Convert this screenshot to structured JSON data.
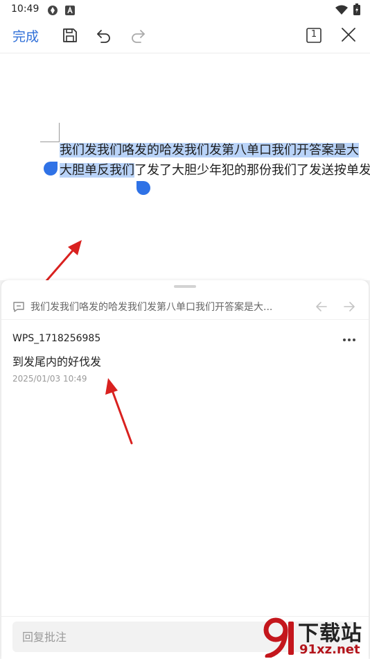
{
  "status_bar": {
    "time": "10:49",
    "icons": [
      "sync-icon",
      "font-a-icon",
      "wifi-icon",
      "battery-icon"
    ]
  },
  "toolbar": {
    "done_label": "完成",
    "icons": [
      "save-icon",
      "undo-icon",
      "redo-icon",
      "page-count-icon",
      "close-icon"
    ],
    "page_count": "1"
  },
  "document": {
    "line1_selected": "我们发我们咯发的哈发我们发第八单口我们开答案是大",
    "line2_selected": "大胆单反我们",
    "line2_rest": "了发了大胆少年犯的那份我们了发送按单发"
  },
  "comment_panel": {
    "quoted_text": "我们发我们咯发的哈发我们发第八单口我们开答案是大...",
    "comment": {
      "author": "WPS_1718256985",
      "text": "到发尾内的好伐发",
      "time": "2025/01/03 10:49"
    },
    "reply_placeholder": "回复批注"
  },
  "watermark": {
    "title": "下载站",
    "domain": "91xz.net"
  },
  "colors": {
    "accent": "#2f6fd8",
    "selection": "#b9d3f8",
    "handle": "#2f72e6",
    "annotation_arrow": "#d9211f"
  }
}
